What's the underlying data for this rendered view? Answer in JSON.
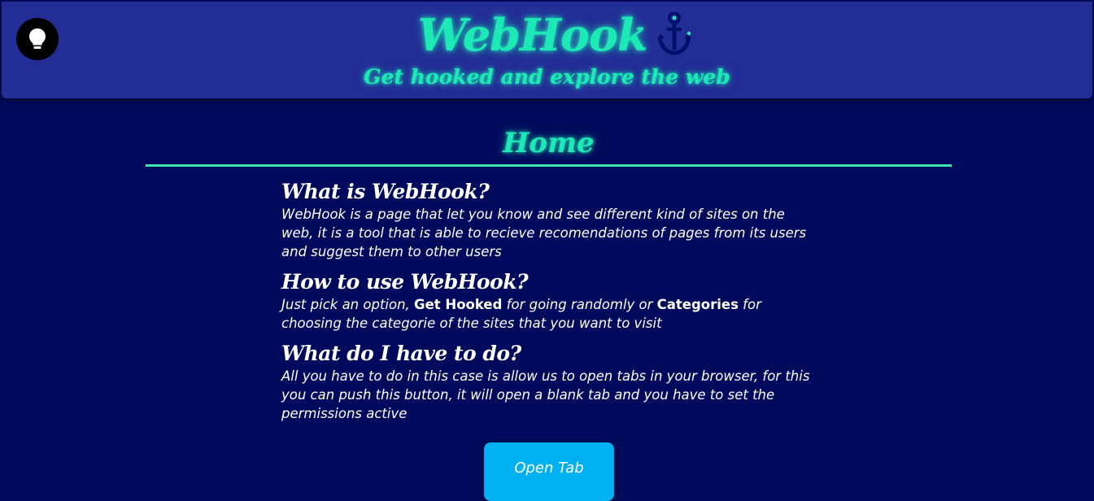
{
  "header": {
    "title": "WebHook",
    "tagline": "Get hooked and explore the web",
    "theme_toggle_icon": "lightbulb-icon",
    "brand_icon": "anchor-icon",
    "accent_color": "#1de9b6",
    "background_color": "#232d96"
  },
  "main": {
    "heading": "Home",
    "sections": [
      {
        "title": "What is WebHook?",
        "body": "WebHook is a page that let you know and see different kind of sites on the web, it is a tool that is able to recieve recomendations of pages from its users and suggest them to other users"
      },
      {
        "title": "How to use WebHook?",
        "body_before": "Just pick an option, ",
        "bold_1": "Get Hooked",
        "body_middle": " for going randomly or ",
        "bold_2": "Categories",
        "body_after": " for choosing the categorie of the sites that you want to visit"
      },
      {
        "title": "What do I have to do?",
        "body": "All you have to do in this case is allow us to open tabs in your browser, for this you can push this button, it will open a blank tab and you have to set the permissions active"
      }
    ],
    "open_tab_label": "Open Tab",
    "button_color": "#00b0f0",
    "page_background": "#000a5c"
  }
}
